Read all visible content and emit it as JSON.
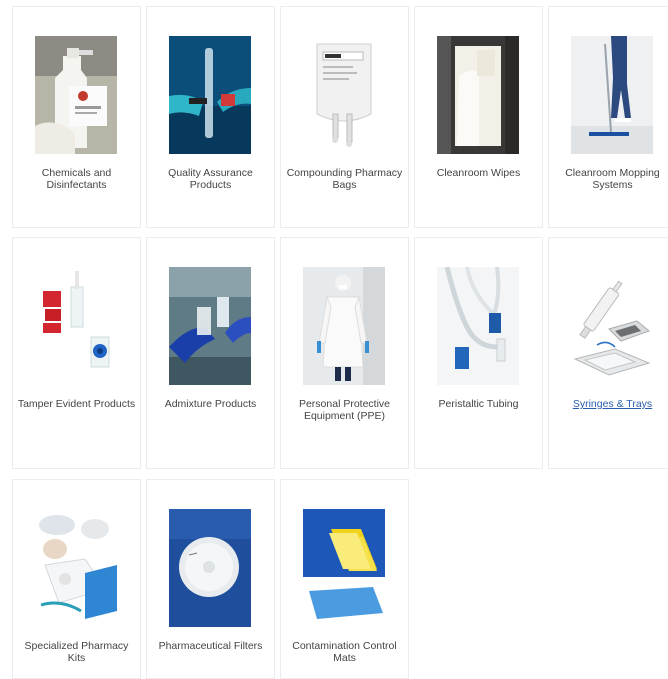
{
  "products": [
    {
      "label": "Chemicals and Disinfectants",
      "icon": "disinfectant-spray-bottle-photo"
    },
    {
      "label": "Quality Assurance Products",
      "icon": "gloved-hands-test-tube-photo"
    },
    {
      "label": "Compounding Pharmacy Bags",
      "icon": "iv-compounding-bag-photo"
    },
    {
      "label": "Cleanroom Wipes",
      "icon": "cleanroom-wipe-glove-photo"
    },
    {
      "label": "Cleanroom Mopping Systems",
      "icon": "cleanroom-mop-photo"
    },
    {
      "label": "Tamper Evident Products",
      "icon": "tamper-evident-caps-photo"
    },
    {
      "label": "Admixture Products",
      "icon": "admixture-vial-photo"
    },
    {
      "label": "Personal Protective Equipment (PPE)",
      "icon": "ppe-gown-person-photo"
    },
    {
      "label": "Peristaltic Tubing",
      "icon": "peristaltic-tubing-photo"
    },
    {
      "label": "Syringes & Trays",
      "icon": "syringe-tray-photo"
    },
    {
      "label": "Specialized Pharmacy Kits",
      "icon": "pharmacy-kit-photo"
    },
    {
      "label": "Pharmaceutical Filters",
      "icon": "syringe-filter-photo"
    },
    {
      "label": "Contamination Control Mats",
      "icon": "contamination-mat-photo"
    }
  ],
  "colors": {
    "link": "#2a5fb0",
    "text": "#444444",
    "border": "#ececec"
  }
}
